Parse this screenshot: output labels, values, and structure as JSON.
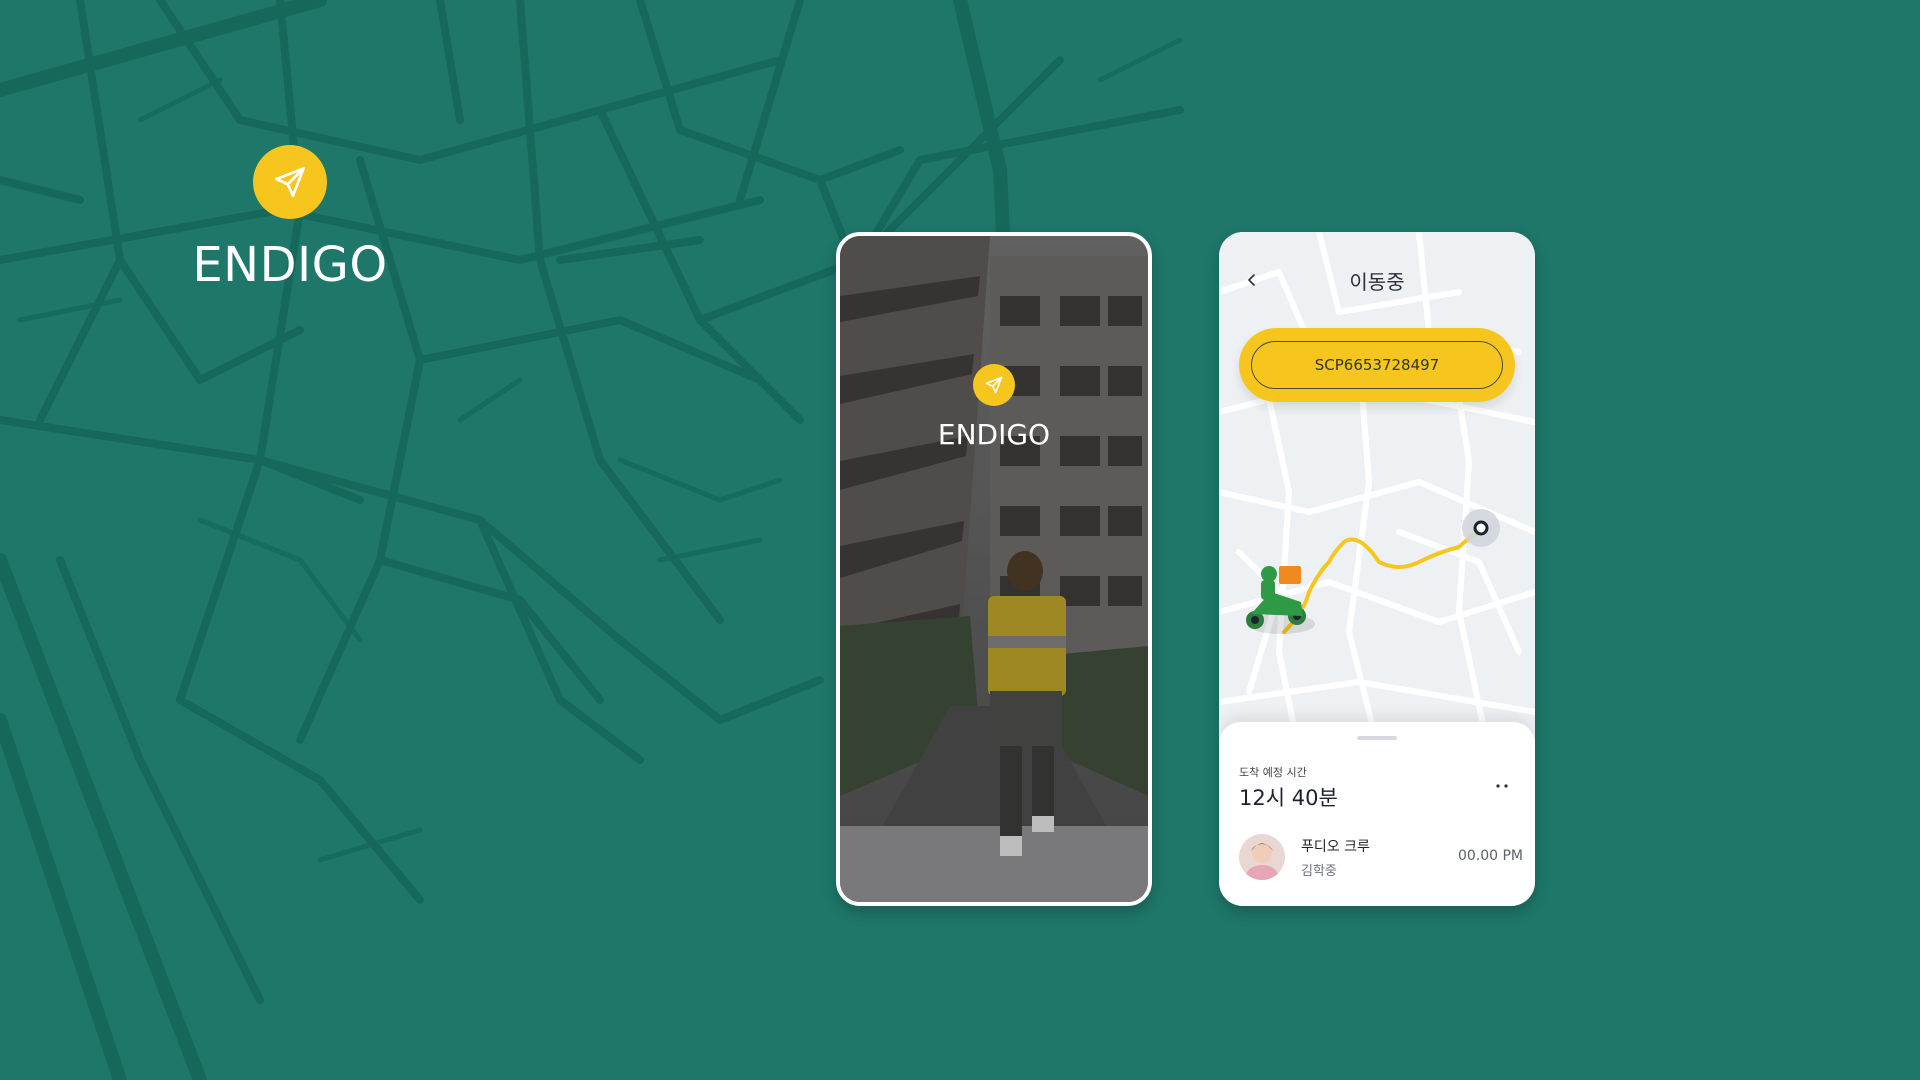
{
  "brand": {
    "name": "ENDIGO",
    "icon": "paper-plane-icon",
    "accent": "#f6c61f",
    "background": "#1e7769"
  },
  "splash_screen": {
    "brand_name": "ENDIGO",
    "icon": "paper-plane-icon"
  },
  "tracking_screen": {
    "title": "이동중",
    "back_icon": "chevron-left-icon",
    "tracking_code": "SCP6653728497",
    "route_color": "#f6c61f",
    "sheet": {
      "eta_label": "도착 예정 시간",
      "eta_value": "12시 40분",
      "more_icon": "more-dots-icon",
      "crew": {
        "team": "푸디오 크루",
        "name": "김학중",
        "time": "00.00 PM"
      }
    }
  }
}
